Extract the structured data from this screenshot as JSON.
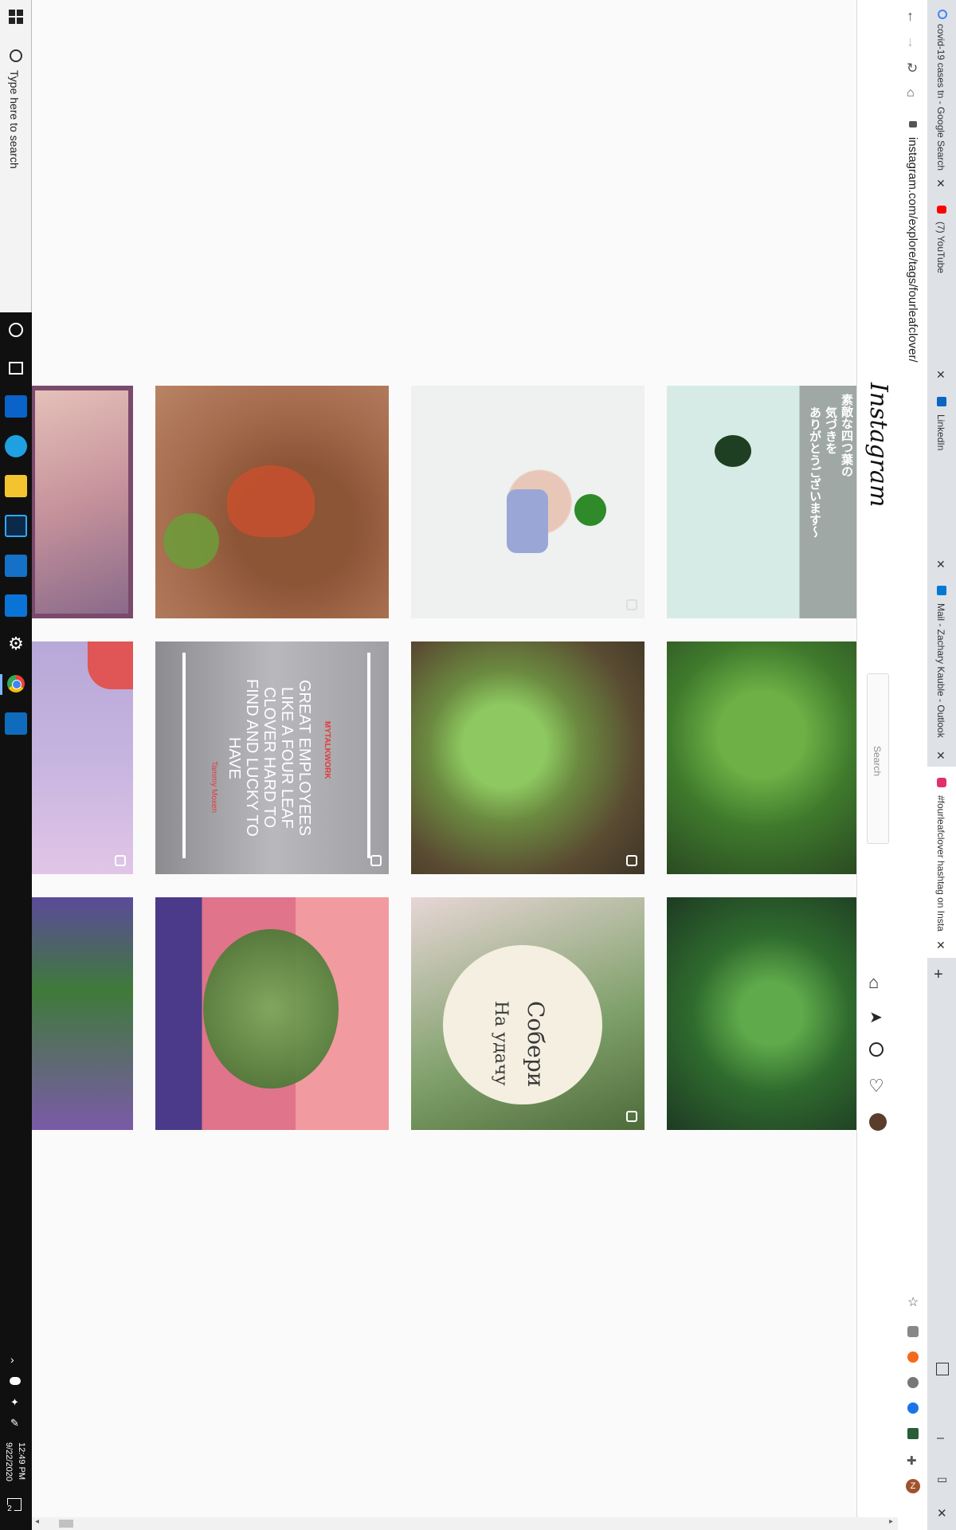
{
  "taskbar": {
    "search_placeholder": "Type here to search",
    "time": "12:49 PM",
    "date": "9/22/2020",
    "notification_count": "2",
    "apps": [
      "start-icon",
      "cortana-icon",
      "task-view-icon",
      "store-icon",
      "edge-icon",
      "file-explorer-icon",
      "photoshop-icon",
      "photos-icon",
      "network-app-icon",
      "settings-icon",
      "chrome-icon",
      "outlook-icon"
    ]
  },
  "browser": {
    "tabs": [
      {
        "label": "covid-19 cases tn - Google Search",
        "icon": "google-icon",
        "color": "#4285f4"
      },
      {
        "label": "(7) YouTube",
        "icon": "youtube-icon",
        "color": "#ff0000"
      },
      {
        "label": "LinkedIn",
        "icon": "linkedin-icon",
        "color": "#0a66c2"
      },
      {
        "label": "Mail - Zachary Kauble - Outlook",
        "icon": "outlook-icon",
        "color": "#0078d4"
      },
      {
        "label": "#fourleafclover hashtag on Insta",
        "icon": "instagram-icon",
        "color": "#e1306c"
      }
    ],
    "url": "instagram.com/explore/tags/fourleafclover/",
    "new_tab": "+",
    "window_controls": {
      "minimize": "–",
      "maximize": "▭",
      "close": "✕"
    }
  },
  "instagram": {
    "logo": "Instagram",
    "search_placeholder": "Search",
    "grid": {
      "tiles": [
        {
          "id": "tile-1",
          "caption": "",
          "bg": "#cfa9b8"
        },
        {
          "id": "tile-2",
          "caption": "",
          "bg": "#9a6a4c"
        },
        {
          "id": "tile-3",
          "caption": "",
          "bg": "#eef0ee"
        },
        {
          "id": "tile-4",
          "caption": "",
          "bg": "#cfe4df"
        },
        {
          "id": "tile-5",
          "caption": "",
          "bg": "#c9b8d6"
        },
        {
          "id": "tile-6",
          "caption": "",
          "bg": "#8a8a8e"
        },
        {
          "id": "tile-7",
          "caption": "",
          "bg": "#5b7a3a"
        },
        {
          "id": "tile-8",
          "caption": "",
          "bg": "#4d8a32"
        },
        {
          "id": "tile-9",
          "caption": "",
          "bg": "#7c6fa8"
        },
        {
          "id": "tile-10",
          "caption": "",
          "bg": "#c77b86"
        },
        {
          "id": "tile-11",
          "caption": "",
          "bg": "#8fb06a"
        },
        {
          "id": "tile-12",
          "caption": "",
          "bg": "#3f7a38"
        }
      ],
      "tile4_text_1": "素敵な四つ葉の",
      "tile4_text_2": "気づきを",
      "tile4_text_3": "ありがとうございます〜",
      "tile6_brand": "MYTALKWORK",
      "tile6_quote": "GREAT EMPLOYEES LIKE A FOUR LEAF CLOVER HARD TO FIND AND LUCKY TO HAVE",
      "tile6_author": "Tammy Moxen",
      "tile11_jar_line1": "Собери",
      "tile11_jar_line2": "На удачу"
    }
  }
}
